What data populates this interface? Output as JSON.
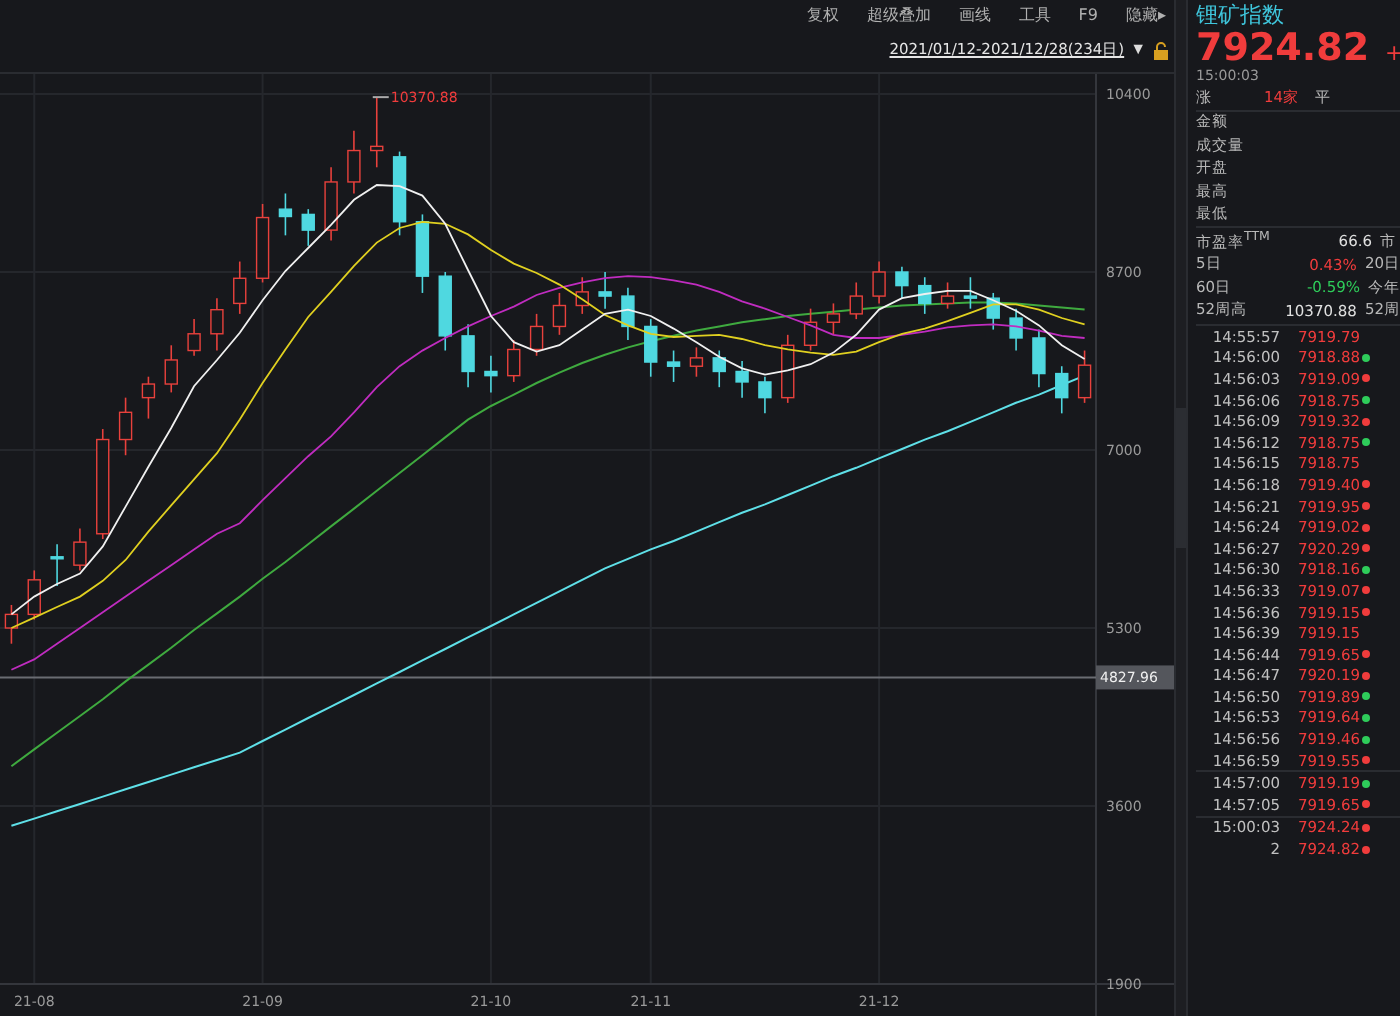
{
  "toolbar": [
    "复权",
    "超级叠加",
    "画线",
    "工具",
    "F9",
    "隐藏▸"
  ],
  "date_range": {
    "text": "2021/01/12-2021/12/28(234日)",
    "menu_glyph": "▼"
  },
  "chart": {
    "chart_data": {
      "type": "candlestick",
      "ylim": [
        1900,
        10400
      ],
      "yticks": [
        10400,
        8700,
        7000,
        5300,
        3600,
        1900
      ],
      "grid": true,
      "ref_lines": [
        {
          "axis": "y",
          "value": 4827.96,
          "label": "4827.96"
        }
      ],
      "annotations": [
        "10370.88"
      ],
      "categories": [
        null,
        "21-08",
        null,
        null,
        null,
        null,
        null,
        null,
        null,
        null,
        null,
        "21-09",
        null,
        null,
        null,
        null,
        null,
        null,
        null,
        null,
        null,
        "21-10",
        null,
        null,
        null,
        null,
        null,
        null,
        "21-11",
        null,
        null,
        null,
        null,
        null,
        null,
        null,
        null,
        null,
        "21-12",
        null,
        null,
        null,
        null,
        null,
        null,
        null,
        null,
        null
      ],
      "ohlc": [
        [
          5300,
          5520,
          5150,
          5430
        ],
        [
          5430,
          5850,
          5380,
          5760
        ],
        [
          5980,
          6100,
          5700,
          5970
        ],
        [
          5900,
          6250,
          5850,
          6120
        ],
        [
          6200,
          7200,
          6150,
          7100
        ],
        [
          7100,
          7500,
          6950,
          7360
        ],
        [
          7500,
          7700,
          7300,
          7630
        ],
        [
          7630,
          8000,
          7550,
          7860
        ],
        [
          7950,
          8250,
          7900,
          8110
        ],
        [
          8110,
          8450,
          7950,
          8340
        ],
        [
          8400,
          8800,
          8300,
          8640
        ],
        [
          8640,
          9350,
          8600,
          9220
        ],
        [
          9300,
          9450,
          9050,
          9230
        ],
        [
          9250,
          9300,
          8950,
          9100
        ],
        [
          9100,
          9700,
          9000,
          9560
        ],
        [
          9560,
          10050,
          9450,
          9860
        ],
        [
          9860,
          10370,
          9700,
          9900
        ],
        [
          9800,
          9850,
          9050,
          9180
        ],
        [
          9180,
          9250,
          8500,
          8660
        ],
        [
          8660,
          8700,
          7950,
          8090
        ],
        [
          8090,
          8200,
          7600,
          7750
        ],
        [
          7750,
          7900,
          7550,
          7710
        ],
        [
          7710,
          8050,
          7650,
          7960
        ],
        [
          7960,
          8300,
          7900,
          8180
        ],
        [
          8180,
          8500,
          8100,
          8380
        ],
        [
          8380,
          8650,
          8300,
          8510
        ],
        [
          8510,
          8700,
          8350,
          8470
        ],
        [
          8470,
          8550,
          8050,
          8180
        ],
        [
          8180,
          8250,
          7700,
          7840
        ],
        [
          7840,
          7950,
          7650,
          7800
        ],
        [
          7800,
          7980,
          7700,
          7880
        ],
        [
          7880,
          7950,
          7600,
          7750
        ],
        [
          7750,
          7850,
          7500,
          7650
        ],
        [
          7650,
          7700,
          7350,
          7500
        ],
        [
          7500,
          8100,
          7450,
          8000
        ],
        [
          8000,
          8350,
          7950,
          8220
        ],
        [
          8220,
          8400,
          8100,
          8300
        ],
        [
          8300,
          8600,
          8250,
          8470
        ],
        [
          8470,
          8800,
          8400,
          8700
        ],
        [
          8700,
          8750,
          8450,
          8570
        ],
        [
          8570,
          8650,
          8300,
          8400
        ],
        [
          8400,
          8600,
          8350,
          8470
        ],
        [
          8470,
          8650,
          8350,
          8450
        ],
        [
          8450,
          8500,
          8150,
          8260
        ],
        [
          8260,
          8350,
          7950,
          8070
        ],
        [
          8070,
          8150,
          7600,
          7730
        ],
        [
          7730,
          7800,
          7350,
          7500
        ],
        [
          7500,
          7950,
          7450,
          7810
        ]
      ],
      "series": [
        {
          "type": "line",
          "color": "#5fe0e8",
          "values": [
            3410,
            3480,
            3550,
            3620,
            3690,
            3760,
            3830,
            3900,
            3970,
            4040,
            4110,
            4220,
            4330,
            4440,
            4550,
            4660,
            4770,
            4880,
            4990,
            5100,
            5210,
            5320,
            5430,
            5540,
            5650,
            5760,
            5870,
            5960,
            6050,
            6130,
            6220,
            6310,
            6400,
            6480,
            6570,
            6660,
            6750,
            6830,
            6920,
            7010,
            7100,
            7180,
            7270,
            7360,
            7450,
            7530,
            7620,
            7710
          ]
        },
        {
          "type": "line",
          "color": "#3faa3f",
          "values": [
            3980,
            4140,
            4300,
            4460,
            4620,
            4790,
            4950,
            5110,
            5280,
            5440,
            5600,
            5770,
            5930,
            6100,
            6270,
            6440,
            6610,
            6780,
            6950,
            7120,
            7290,
            7420,
            7530,
            7640,
            7740,
            7830,
            7910,
            7980,
            8040,
            8090,
            8140,
            8180,
            8220,
            8250,
            8280,
            8300,
            8320,
            8340,
            8360,
            8380,
            8390,
            8400,
            8410,
            8410,
            8400,
            8380,
            8360,
            8340
          ]
        },
        {
          "type": "line",
          "color": "#c02cc0",
          "values": [
            4900,
            5000,
            5150,
            5300,
            5450,
            5600,
            5750,
            5900,
            6050,
            6200,
            6300,
            6520,
            6730,
            6940,
            7130,
            7360,
            7600,
            7800,
            7950,
            8070,
            8180,
            8280,
            8370,
            8480,
            8550,
            8600,
            8640,
            8660,
            8650,
            8620,
            8580,
            8510,
            8420,
            8350,
            8270,
            8190,
            8100,
            8070,
            8070,
            8100,
            8130,
            8170,
            8190,
            8200,
            8180,
            8140,
            8090,
            8070
          ]
        },
        {
          "type": "line",
          "color": "#e0d020",
          "values": [
            5300,
            5400,
            5500,
            5600,
            5750,
            5950,
            6220,
            6470,
            6720,
            6970,
            7290,
            7640,
            7960,
            8270,
            8510,
            8760,
            8980,
            9120,
            9180,
            9160,
            9060,
            8910,
            8780,
            8690,
            8580,
            8440,
            8290,
            8190,
            8110,
            8080,
            8090,
            8100,
            8060,
            8000,
            7960,
            7930,
            7910,
            7940,
            8030,
            8110,
            8160,
            8230,
            8310,
            8390,
            8390,
            8340,
            8260,
            8200
          ]
        },
        {
          "type": "line",
          "color": "#f0f0f0",
          "values": [
            5430,
            5600,
            5720,
            5820,
            6080,
            6460,
            6840,
            7210,
            7610,
            7860,
            8120,
            8430,
            8710,
            8930,
            9150,
            9390,
            9530,
            9520,
            9430,
            9160,
            8720,
            8280,
            8030,
            7940,
            8000,
            8150,
            8300,
            8340,
            8280,
            8160,
            8030,
            7890,
            7780,
            7720,
            7760,
            7820,
            7930,
            8100,
            8340,
            8450,
            8490,
            8520,
            8520,
            8430,
            8330,
            8190,
            8000,
            7870
          ]
        }
      ]
    }
  },
  "quote": {
    "name": "锂矿指数",
    "price": "7924.82",
    "change": "+",
    "time": "15:00:03"
  },
  "breadth": {
    "label": "涨",
    "count": "14家",
    "flat_label": "平"
  },
  "fields": [
    "金额",
    "成交量",
    "开盘",
    "最高",
    "最低"
  ],
  "stats": [
    {
      "label": "市盈率$^{TTM}$",
      "value": "66.6",
      "color": "#e0e0e0",
      "label_2": "市"
    },
    {
      "label": "5日",
      "value": "0.43%",
      "color": "#f03c3c",
      "label_2": "20日"
    },
    {
      "label": "60日",
      "value": "-0.59%",
      "color": "#2ecc5a",
      "label_2": "今年"
    },
    {
      "label": "52周高",
      "value": "10370.88",
      "color": "#e0e0e0",
      "label_2": "52周"
    }
  ],
  "ticks": [
    {
      "time": "14:55:57",
      "price": "7919.79"
    },
    {
      "time": "14:56:00",
      "price": "7918.88",
      "color": "#2ecc5a"
    },
    {
      "time": "14:56:03",
      "price": "7919.09",
      "color": "#f03c3c"
    },
    {
      "time": "14:56:06",
      "price": "7918.75",
      "color": "#2ecc5a"
    },
    {
      "time": "14:56:09",
      "price": "7919.32",
      "color": "#f03c3c"
    },
    {
      "time": "14:56:12",
      "price": "7918.75",
      "color": "#2ecc5a"
    },
    {
      "time": "14:56:15",
      "price": "7918.75"
    },
    {
      "time": "14:56:18",
      "price": "7919.40",
      "color": "#f03c3c"
    },
    {
      "time": "14:56:21",
      "price": "7919.95",
      "color": "#f03c3c"
    },
    {
      "time": "14:56:24",
      "price": "7919.02",
      "color": "#f03c3c"
    },
    {
      "time": "14:56:27",
      "price": "7920.29",
      "color": "#f03c3c"
    },
    {
      "time": "14:56:30",
      "price": "7918.16",
      "color": "#2ecc5a"
    },
    {
      "time": "14:56:33",
      "price": "7919.07",
      "color": "#f03c3c"
    },
    {
      "time": "14:56:36",
      "price": "7919.15",
      "color": "#f03c3c"
    },
    {
      "time": "14:56:39",
      "price": "7919.15"
    },
    {
      "time": "14:56:44",
      "price": "7919.65",
      "color": "#f03c3c"
    },
    {
      "time": "14:56:47",
      "price": "7920.19",
      "color": "#f03c3c"
    },
    {
      "time": "14:56:50",
      "price": "7919.89",
      "color": "#2ecc5a"
    },
    {
      "time": "14:56:53",
      "price": "7919.64",
      "color": "#2ecc5a"
    },
    {
      "time": "14:56:56",
      "price": "7919.46",
      "color": "#2ecc5a"
    },
    {
      "time": "14:56:59",
      "price": "7919.55",
      "color": "#f03c3c"
    },
    {
      "time": "14:57:00",
      "price": "7919.19",
      "color": "#2ecc5a"
    },
    {
      "time": "14:57:05",
      "price": "7919.65",
      "color": "#f03c3c"
    },
    {
      "time": "15:00:03",
      "price": "7924.24",
      "color": "#f03c3c"
    },
    {
      "time": "2",
      "price": "7924.82",
      "color": "#f03c3c"
    }
  ]
}
